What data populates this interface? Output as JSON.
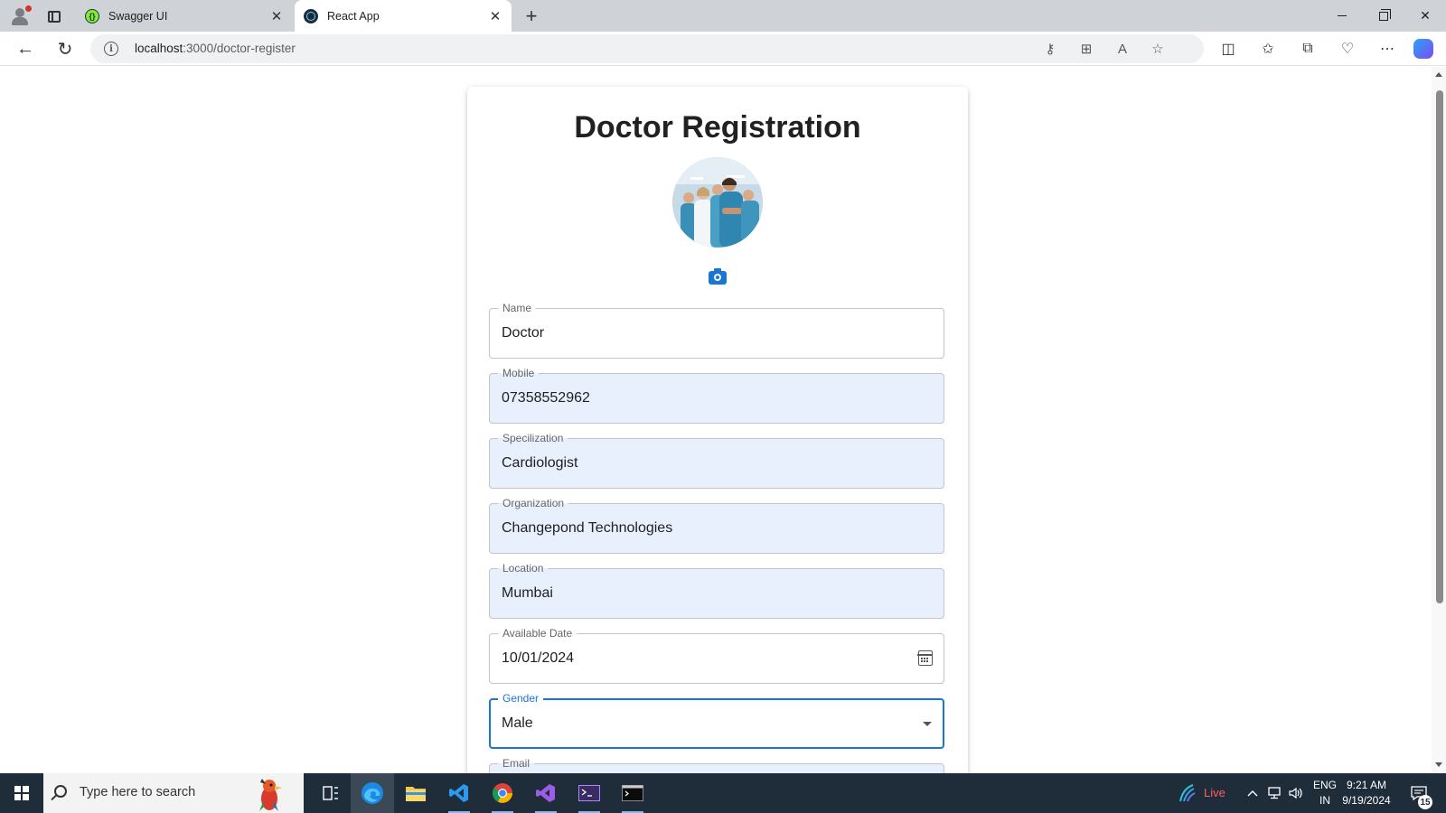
{
  "browser": {
    "tabs": [
      {
        "title": "Swagger UI",
        "active": false
      },
      {
        "title": "React App",
        "active": true
      }
    ],
    "url_host": "localhost",
    "url_path": ":3000/doctor-register"
  },
  "form": {
    "title": "Doctor Registration",
    "fields": {
      "name": {
        "label": "Name",
        "value": "Doctor"
      },
      "mobile": {
        "label": "Mobile",
        "value": "07358552962"
      },
      "specialization": {
        "label": "Specilization",
        "value": "Cardiologist"
      },
      "organization": {
        "label": "Organization",
        "value": "Changepond Technologies"
      },
      "location": {
        "label": "Location",
        "value": "Mumbai"
      },
      "available_date": {
        "label": "Available Date",
        "value": "10/01/2024"
      },
      "gender": {
        "label": "Gender",
        "value": "Male"
      },
      "email": {
        "label": "Email",
        "value": ""
      }
    },
    "accent_color": "#1976d2",
    "autofill_bg": "#e8f0fe"
  },
  "taskbar": {
    "search_placeholder": "Type here to search",
    "live_label": "Live",
    "language": "ENG",
    "region": "IN",
    "time": "9:21 AM",
    "date": "9/19/2024",
    "notification_count": "15"
  }
}
